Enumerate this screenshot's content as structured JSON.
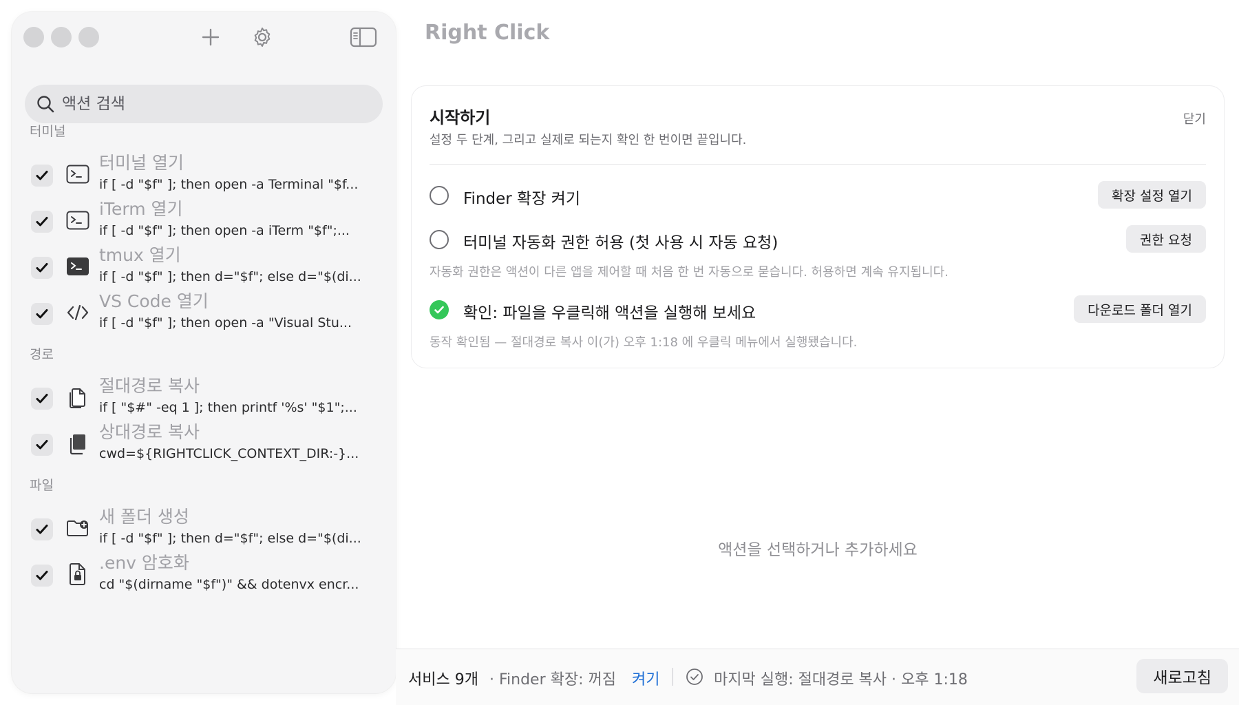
{
  "sidebar": {
    "search": {
      "placeholder": "액션 검색"
    },
    "sections": [
      {
        "title": "터미널",
        "items": [
          {
            "name": "터미널 열기",
            "command": "if [ -d \"$f\" ]; then open -a Terminal \"$f...",
            "icon": "terminal-icon",
            "checked": true
          },
          {
            "name": "iTerm 열기",
            "command": "if [ -d \"$f\" ]; then open -a iTerm \"$f\";...",
            "icon": "terminal-icon",
            "checked": true
          },
          {
            "name": "tmux 열기",
            "command": "if [ -d \"$f\" ]; then d=\"$f\"; else d=\"$(di...",
            "icon": "terminal-filled-icon",
            "checked": true
          },
          {
            "name": "VS Code 열기",
            "command": "if [ -d \"$f\" ]; then open -a \"Visual Stu...",
            "icon": "code-icon",
            "checked": true
          }
        ]
      },
      {
        "title": "경로",
        "items": [
          {
            "name": "절대경로 복사",
            "command": "if [ \"$#\" -eq 1 ]; then printf '%s' \"$1\";...",
            "icon": "copy-document-icon",
            "checked": true
          },
          {
            "name": "상대경로 복사",
            "command": "cwd=${RIGHTCLICK_CONTEXT_DIR:-}...",
            "icon": "copy-filled-icon",
            "checked": true
          }
        ]
      },
      {
        "title": "파일",
        "items": [
          {
            "name": "새 폴더 생성",
            "command": "if [ -d \"$f\" ]; then d=\"$f\"; else d=\"$(di...",
            "icon": "folder-add-icon",
            "checked": true
          },
          {
            "name": ".env 암호화",
            "command": "cd \"$(dirname \"$f\")\" && dotenvx encr...",
            "icon": "lock-document-icon",
            "checked": true
          }
        ]
      }
    ]
  },
  "main": {
    "title": "Right Click",
    "getting_started": {
      "title": "시작하기",
      "subtitle": "설정 두 단계, 그리고 실제로 되는지 확인 한 번이면 끝입니다.",
      "close_label": "닫기",
      "steps": [
        {
          "label": "Finder 확장 켜기",
          "button": "확장 설정 열기",
          "done": false
        },
        {
          "label": "터미널 자동화 권한 허용 (첫 사용 시 자동 요청)",
          "button": "권한 요청",
          "done": false,
          "note": "자동화 권한은 액션이 다른 앱을 제어할 때 처음 한 번 자동으로 묻습니다. 허용하면 계속 유지됩니다."
        },
        {
          "label": "확인: 파일을 우클릭해 액션을 실행해 보세요",
          "button": "다운로드 폴더 열기",
          "done": true,
          "note": "동작 확인됨 — 절대경로 복사 이(가) 오후 1:18 에 우클릭 메뉴에서 실행됐습니다."
        }
      ]
    },
    "empty_message": "액션을 선택하거나 추가하세요"
  },
  "statusbar": {
    "service_count": "서비스 9개",
    "finder_status": "· Finder 확장: 꺼짐",
    "enable_link": "켜기",
    "last_run": "마지막 실행: 절대경로 복사 · 오후 1:18",
    "refresh_label": "새로고침"
  },
  "colors": {
    "accent_link": "#1f6fd6",
    "success": "#34c759",
    "sidebar_bg": "#f5f5f6"
  }
}
